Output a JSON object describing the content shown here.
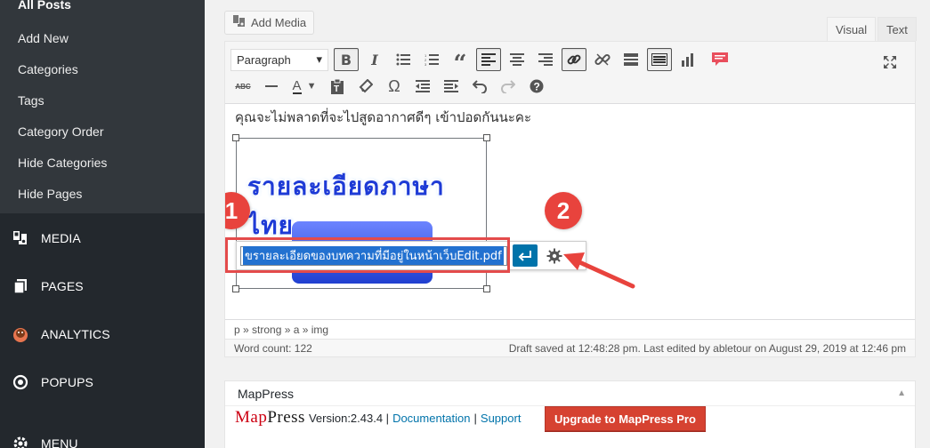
{
  "sidebar": {
    "submenu": [
      {
        "label": "All Posts"
      },
      {
        "label": "Add New"
      },
      {
        "label": "Categories"
      },
      {
        "label": "Tags"
      },
      {
        "label": "Category Order"
      },
      {
        "label": "Hide Categories"
      },
      {
        "label": "Hide Pages"
      }
    ],
    "menu": [
      {
        "label": "MEDIA",
        "icon": "media-icon"
      },
      {
        "label": "PAGES",
        "icon": "pages-icon"
      },
      {
        "label": "ANALYTICS",
        "icon": "analytics-icon"
      },
      {
        "label": "POPUPS",
        "icon": "popups-icon"
      },
      {
        "label": "MENU",
        "icon": "gear-icon"
      }
    ]
  },
  "editor": {
    "add_media_label": "Add Media",
    "tabs": {
      "visual": "Visual",
      "text": "Text"
    },
    "format_select": "Paragraph",
    "content_text": "คุณจะไม่พลาดที่จะไปสูดอากาศดีๆ เข้าปอดกันนะคะ",
    "image_text": "รายละเอียดภาษาไทย",
    "link_value": "ขรายละเอียดของบทความที่มีอยู่ในหน้าเว็บEdit.pdf",
    "badge_1": "1",
    "badge_2": "2",
    "path": "p » strong » a » img",
    "word_count": "Word count: 122",
    "draft_status": "Draft saved at 12:48:28 pm. Last edited by abletour on August 29, 2019 at 12:46 pm"
  },
  "mappress": {
    "title": "MapPress",
    "logo_a": "Map",
    "logo_b": "Press",
    "version": "Version:2.43.4 |",
    "documentation": "Documentation",
    "separator": "|",
    "support": "Support",
    "upgrade_label": "Upgrade to MapPress Pro"
  },
  "colors": {
    "sidebar_bg": "#23282d",
    "submenu_bg": "#32373c",
    "accent_blue": "#0073aa",
    "annotation_red": "#e8433d",
    "upgrade_red": "#d64231"
  }
}
